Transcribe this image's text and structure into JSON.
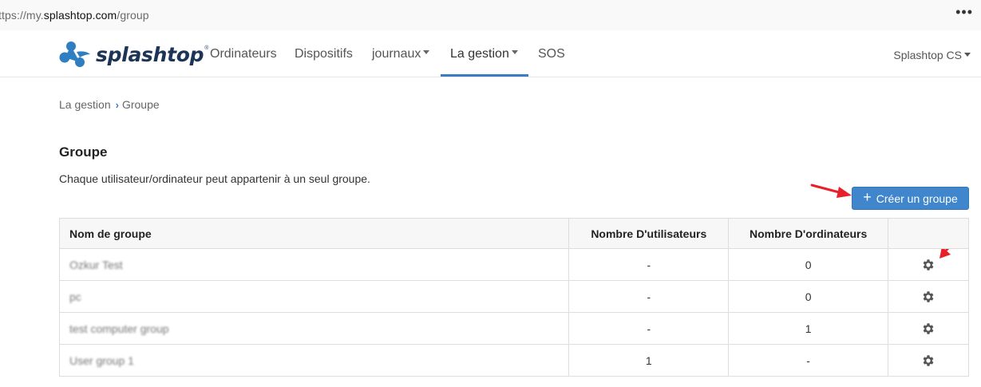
{
  "browser": {
    "url_prefix": "ttps://my.",
    "url_domain": "splashtop.com",
    "url_path": "/group",
    "more_label": "•••"
  },
  "nav": {
    "logo_text": "splashtop",
    "logo_mark": "®",
    "items": [
      {
        "label": "Ordinateurs"
      },
      {
        "label": "Dispositifs"
      },
      {
        "label": "journaux"
      },
      {
        "label": "La gestion"
      },
      {
        "label": "SOS"
      }
    ],
    "active": "La gestion",
    "account": "Splashtop CS"
  },
  "breadcrumb": {
    "parent": "La gestion",
    "chevron": "›",
    "current": "Groupe"
  },
  "page": {
    "title": "Groupe",
    "description": "Chaque utilisateur/ordinateur peut appartenir à un seul groupe.",
    "create_button_icon": "+",
    "create_button_label": "Créer un groupe"
  },
  "table": {
    "headers": [
      "Nom de groupe",
      "Nombre D'utilisateurs",
      "Nombre D'ordinateurs",
      ""
    ],
    "rows": [
      {
        "name": "Ozkur Test",
        "users": "-",
        "computers": "0",
        "action_icon": "gear-icon"
      },
      {
        "name": "pc",
        "users": "-",
        "computers": "0",
        "action_icon": "gear-icon"
      },
      {
        "name": "test computer group",
        "users": "-",
        "computers": "1",
        "action_icon": "gear-icon"
      },
      {
        "name": "User group 1",
        "users": "1",
        "computers": "-",
        "action_icon": "gear-icon"
      }
    ]
  },
  "colors": {
    "accent": "#3a7dc2",
    "button": "#3f86cc",
    "annotation_arrow": "#e8202a"
  }
}
